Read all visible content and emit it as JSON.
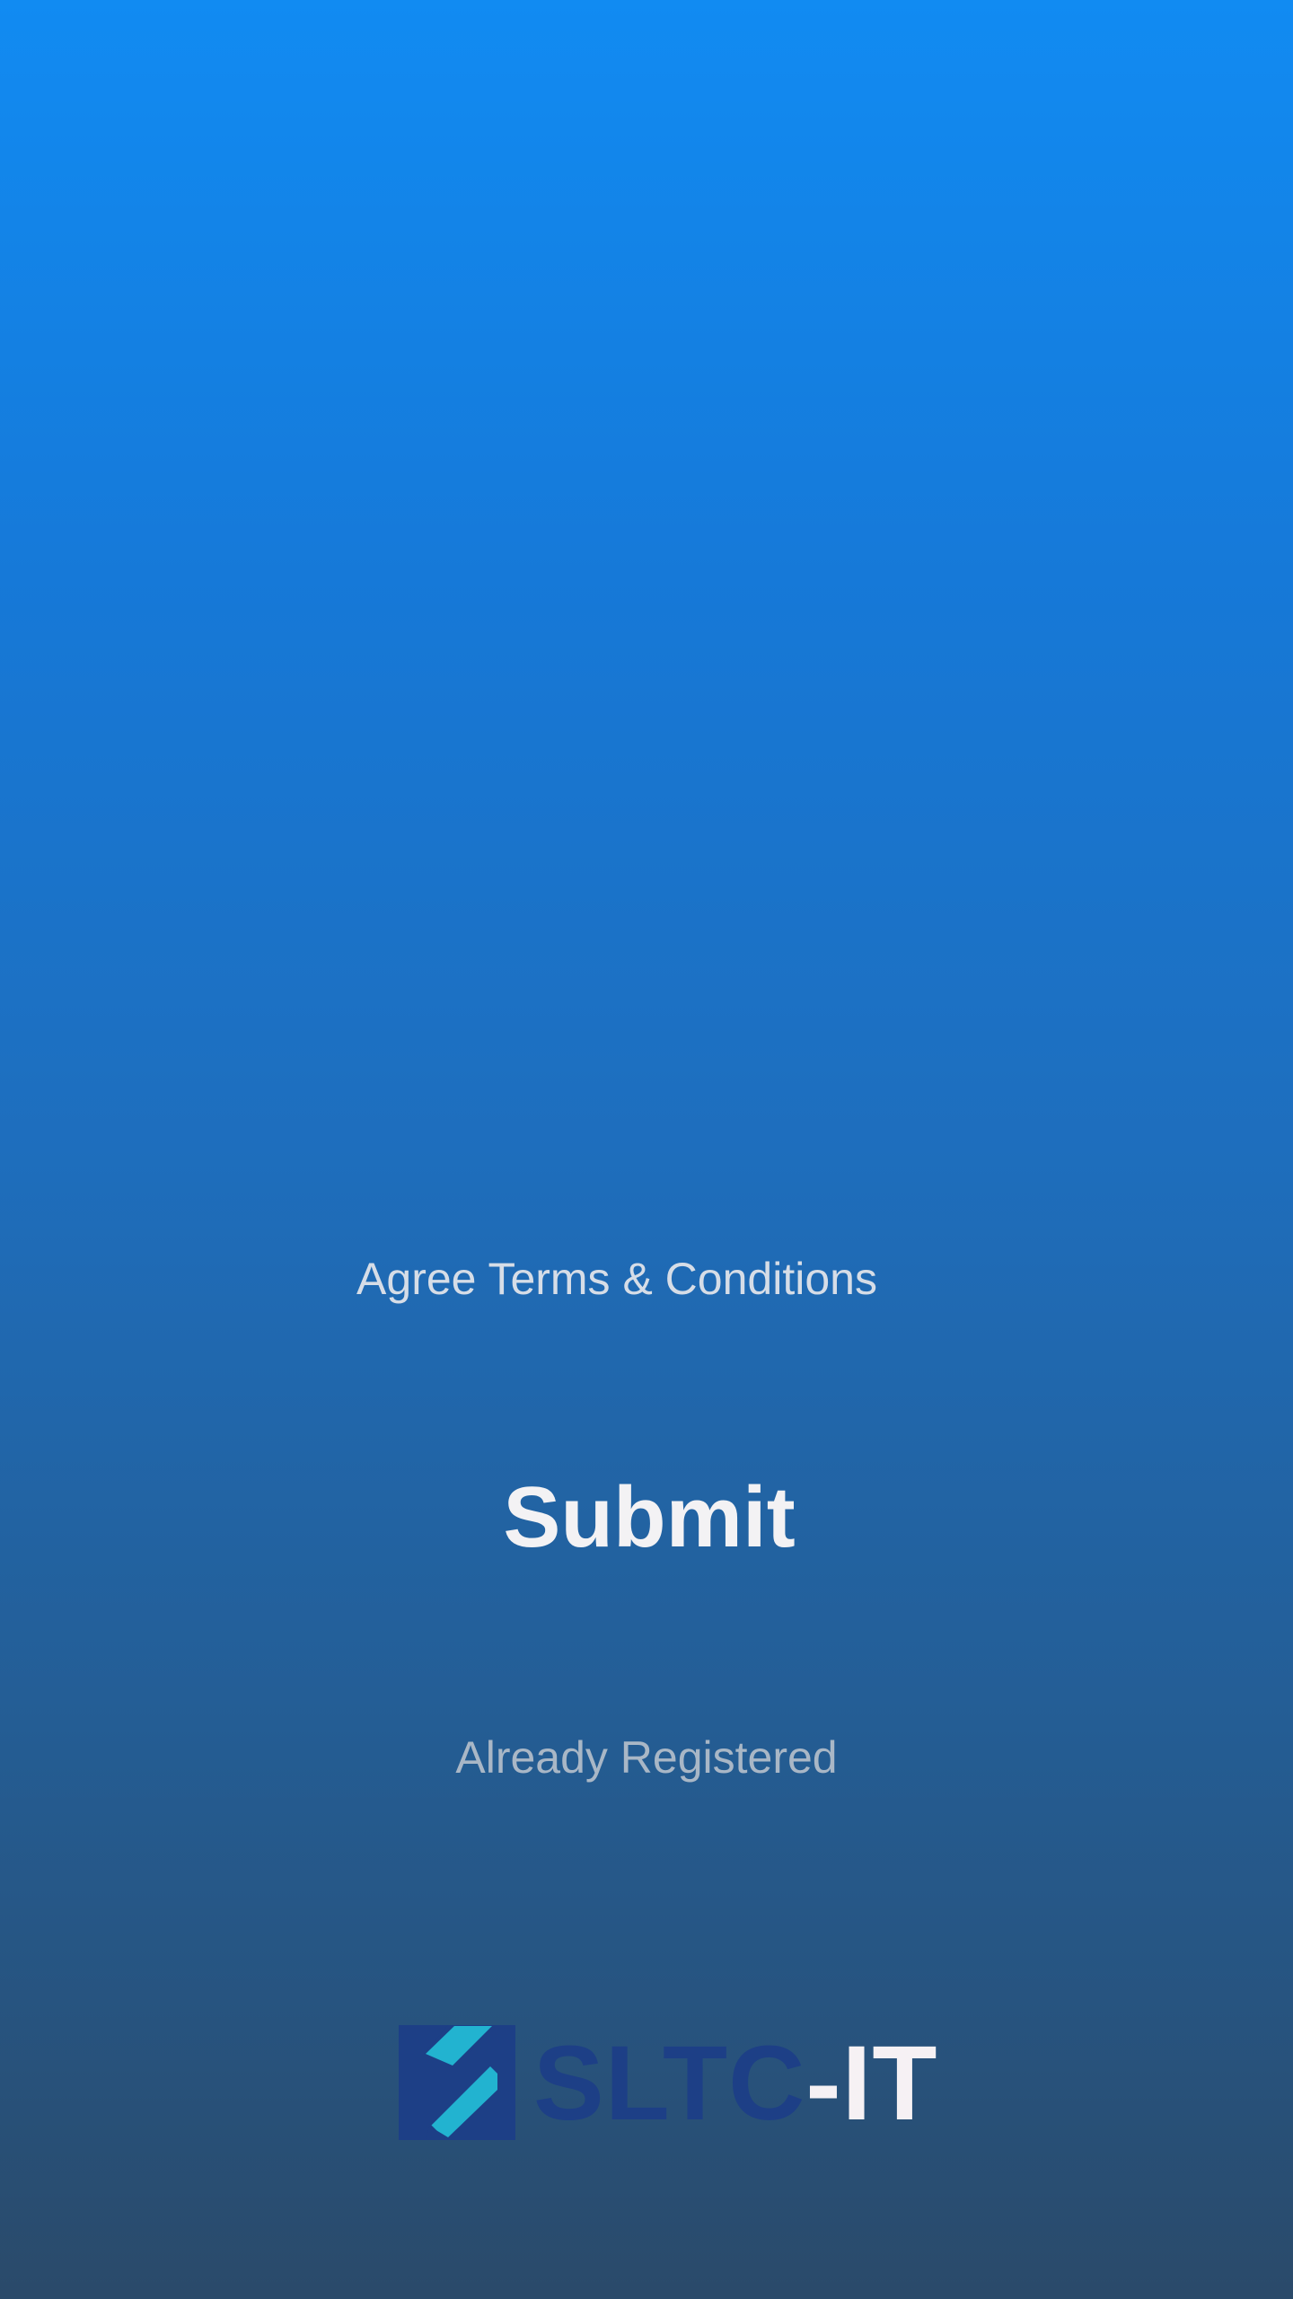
{
  "form": {
    "terms_label": "Agree Terms & Conditions",
    "submit_label": "Submit",
    "already_registered_label": "Already Registered"
  },
  "brand": {
    "logo_icon": "sltc-logo-mark",
    "name_primary": "SLTC",
    "name_suffix": "-IT",
    "colors": {
      "mark_background": "#1d3f86",
      "mark_stripe": "#22b3d0",
      "primary_text": "#1d3f86",
      "suffix_text": "#f6f1f4"
    }
  },
  "theme": {
    "gradient_top": "#118bf2",
    "gradient_bottom": "#2a4a6a"
  }
}
